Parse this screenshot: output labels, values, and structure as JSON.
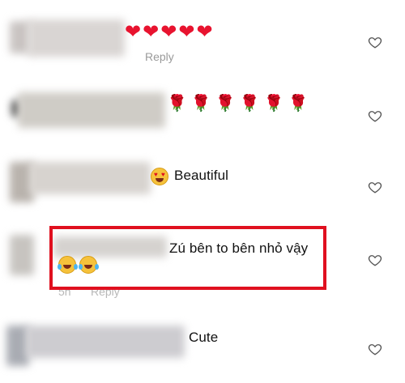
{
  "comments": [
    {
      "text": "",
      "emojis": [
        "❤",
        "❤",
        "❤",
        "❤",
        "❤"
      ],
      "meta": "Reply"
    },
    {
      "text": "",
      "emojis": [
        "🌹",
        "🌹",
        "🌹",
        "🌹",
        "🌹",
        "🌹"
      ],
      "meta": ""
    },
    {
      "text": "Beautiful",
      "emojis": [
        "heart-eyes-emoji"
      ],
      "meta": ""
    },
    {
      "text": "Zú bên to bên nhỏ vậy",
      "emojis": [
        "laughing-tears-emoji",
        "laughing-tears-emoji"
      ],
      "time": "5h",
      "meta": "Reply",
      "highlighted": true
    },
    {
      "text": "Cute",
      "emojis": [],
      "meta": ""
    }
  ],
  "colors": {
    "highlight": "#e0101f",
    "heart": "#e8132f",
    "meta_text": "#9a9a9a"
  },
  "icons": {
    "like": "heart-outline-icon"
  }
}
